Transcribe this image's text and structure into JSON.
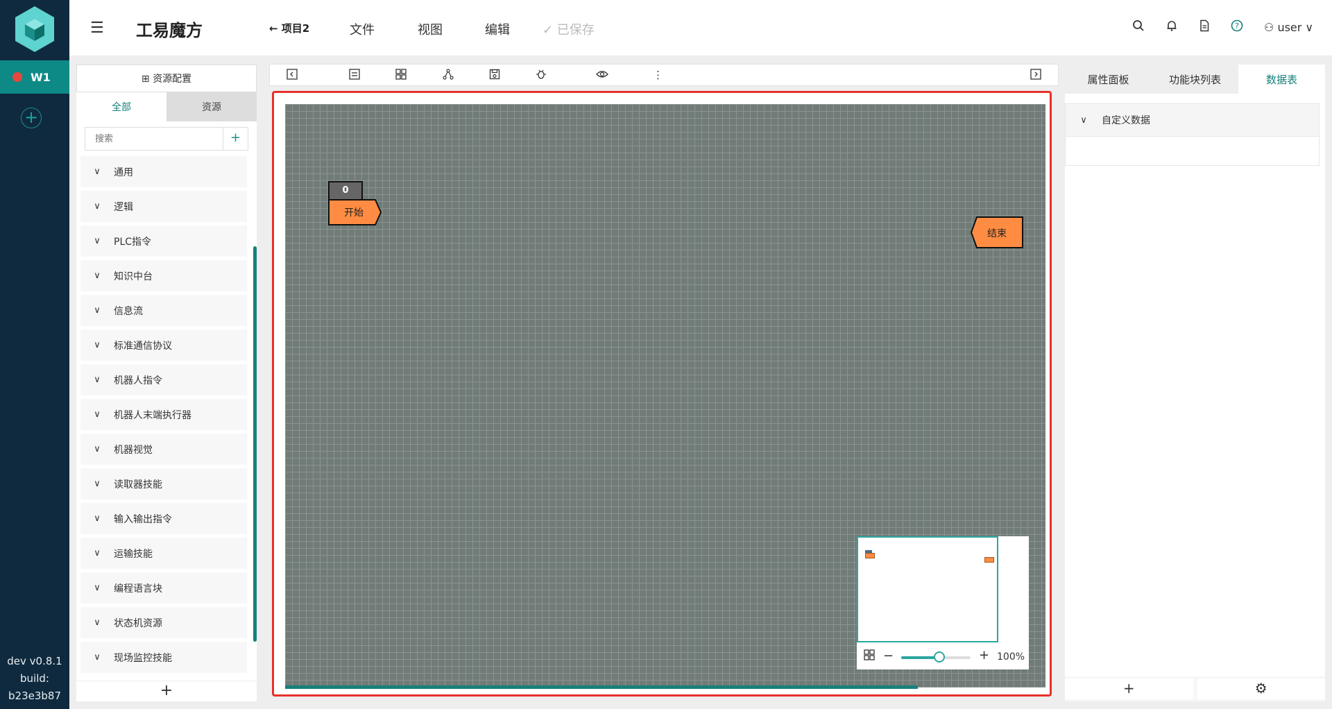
{
  "rail": {
    "workspace_label": "W1",
    "add_label": "+",
    "version": "dev v0.8.1",
    "build_label": "build:",
    "build_id": "b23e3b87"
  },
  "topbar": {
    "menu_icon": "menu-fold-icon",
    "title": "工易魔方",
    "back_label": "← 项目2",
    "nav": [
      "文件",
      "视图",
      "编辑"
    ],
    "saved_label": "✓ 已保存",
    "user_label": "user ∨"
  },
  "left_panel": {
    "resource_config": "⊞ 资源配置",
    "tabs": [
      "全部",
      "资源"
    ],
    "search_placeholder": "搜索",
    "add_label": "+",
    "categories": [
      "通用",
      "逻辑",
      "PLC指令",
      "知识中台",
      "信息流",
      "标准通信协议",
      "机器人指令",
      "机器人末端执行器",
      "机器视觉",
      "读取器技能",
      "输入输出指令",
      "运输技能",
      "编程语言块",
      "状态机资源",
      "现场监控技能"
    ],
    "footer_add": "+"
  },
  "toolbar": {
    "icons": [
      "collapse-left-icon",
      "settings-panel-icon",
      "fit-view-icon",
      "graph-layout-icon",
      "save-icon",
      "debug-bug-icon",
      "eye-preview-icon",
      "more-icon",
      "collapse-right-icon"
    ]
  },
  "canvas": {
    "start_badge": "0",
    "start_label": "开始",
    "end_label": "结束",
    "node_color": "#ff8c42",
    "minimap_zoom": "100%",
    "zoom_level": 0.55
  },
  "right_panel": {
    "tabs": [
      "属性面板",
      "功能块列表",
      "数据表"
    ],
    "section_title": "自定义数据",
    "footer_add": "+",
    "footer_settings": "⚙"
  },
  "colors": {
    "accent": "#14807b",
    "rail": "#0f2a3e",
    "highlight": "#e8302c"
  }
}
